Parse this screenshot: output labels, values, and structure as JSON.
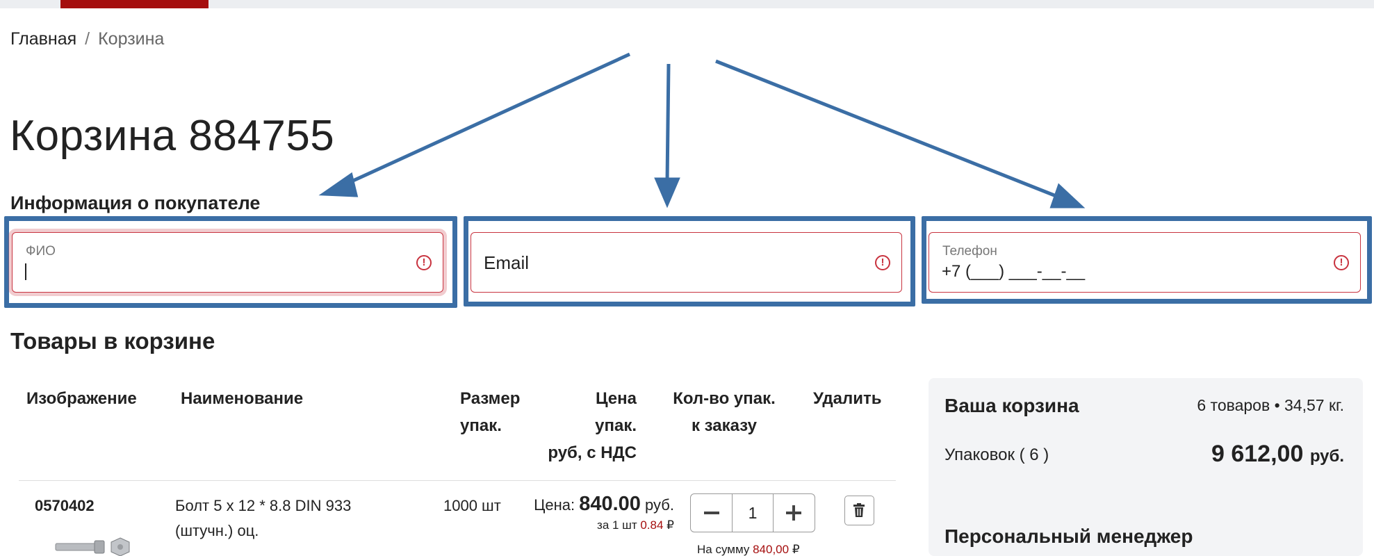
{
  "breadcrumb": {
    "home": "Главная",
    "separator": "/",
    "current": "Корзина"
  },
  "page_title": "Корзина 884755",
  "buyer_section": {
    "heading": "Информация о покупателе",
    "fio": {
      "label": "ФИО",
      "value": ""
    },
    "email": {
      "placeholder": "Email"
    },
    "phone": {
      "label": "Телефон",
      "value": "+7 (___) ___-__-__"
    },
    "warn_icon": "!"
  },
  "cart_section": {
    "heading": "Товары в корзине",
    "columns": {
      "image": "Изображение",
      "name": "Наименование",
      "size_l1": "Размер",
      "size_l2": "упак.",
      "price_l1": "Цена",
      "price_l2": "упак.",
      "price_l3": "руб, с НДС",
      "qty_l1": "Кол-во упак.",
      "qty_l2": "к заказу",
      "delete": "Удалить"
    },
    "rows": [
      {
        "article": "0570402",
        "name_l1": "Болт 5 х 12 * 8.8 DIN 933",
        "name_l2": "(штучн.) оц.",
        "pack_size": "1000 шт",
        "price_label": "Цена:",
        "price": "840.00",
        "price_unit": "руб.",
        "per_unit_label": "за 1 шт",
        "per_unit_price": "0.84",
        "currency_sign": "₽",
        "qty": "1",
        "sum_label": "На сумму",
        "sum_value": "840,00"
      }
    ]
  },
  "summary": {
    "title": "Ваша корзина",
    "info": "6 товаров • 34,57 кг.",
    "packs_label": "Упаковок ( 6 )",
    "total": "9 612,00",
    "total_unit": "руб.",
    "manager_heading": "Персональный менеджер"
  },
  "colors": {
    "accent": "#a50e0e",
    "error": "#c8333f",
    "annotation": "#3b6ea5"
  },
  "icons": {
    "minus": "minus-icon",
    "plus": "plus-icon",
    "trash": "trash-icon",
    "warning": "alert-circle-icon"
  }
}
